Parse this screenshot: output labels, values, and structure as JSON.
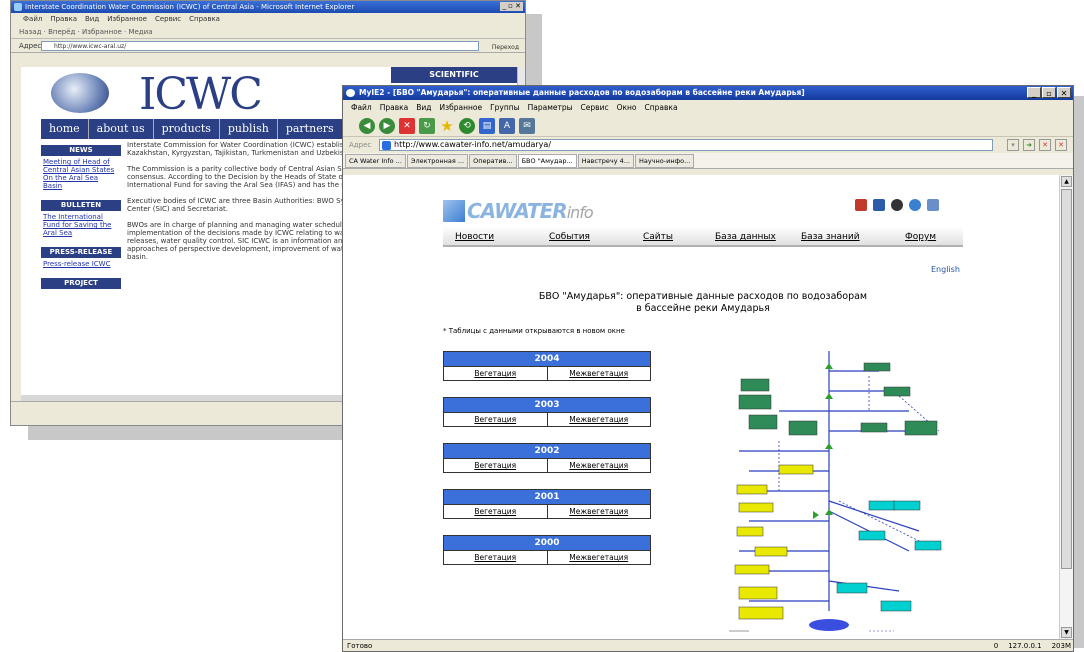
{
  "back_window": {
    "title": "Interstate Coordination Water Commission (ICWC) of Central Asia - Microsoft Internet Explorer",
    "menu": [
      "Файл",
      "Правка",
      "Вид",
      "Избранное",
      "Сервис",
      "Справка"
    ],
    "toolbar": "Назад · Вперёд · Избранное · Медиа",
    "address_label": "Адрес",
    "address": "http://www.icwc-aral.uz/",
    "go": "Переход",
    "scientific": "SCIENTIFIC",
    "logo": "ICWC",
    "nav": [
      "home",
      "about us",
      "products",
      "publish",
      "partners"
    ],
    "side": [
      {
        "header": "NEWS",
        "link": "Meeting of Head of Central Asian States On the Aral Sea Basin"
      },
      {
        "header": "BULLETEN",
        "link": "The International Fund for Saving the Aral Sea"
      },
      {
        "header": "PRESS-RELEASE",
        "link": "Press-release ICWC"
      },
      {
        "header": "PROJECT",
        "link": ""
      }
    ],
    "paragraphs": [
      "Interstate Commission for Water Coordination (ICWC) established after signing of the Agreement between Kazakhstan, Kyrgyzstan, Tajikistan, Turkmenistan and Uzbekistan on February 18, 1992.",
      "The Commission is a parity collective body of Central Asian States acting on the basis of equity, equality and consensus. According to the Decision by the Heads of State of March 1993, ICWC was included in the International Fund for saving the Aral Sea (IFAS) and has the status of an international organization.",
      "Executive bodies of ICWC are three Basin Authorities: BWO Syrdarya and Amudarya, Scientific-Information Center (SIC) and Secretariat.",
      "BWOs are in charge of planning and managing water schedules and water resources distribution, as well as implementation of the decisions made by ICWC relating to water allocation, schedules of water flow and releases, water quality control. SIC ICWC is an information and analytic center which develops methods and approaches of perspective development, improvement of water management and ecological situation in the basin."
    ]
  },
  "front_window": {
    "title": "MyIE2 - [БВО \"Амударья\": оперативные данные расходов по водозаборам в бассейне реки Амударья]",
    "menu": [
      "Файл",
      "Правка",
      "Вид",
      "Избранное",
      "Группы",
      "Параметры",
      "Сервис",
      "Окно",
      "Справка"
    ],
    "address_label": "Адрес",
    "address": "http://www.cawater-info.net/amudarya/",
    "tabs": [
      "CA Water Info ...",
      "Электронная ...",
      "Оператив...",
      "БВО \"Амудар...",
      "Навстречу 4...",
      "Научно-инфо..."
    ],
    "active_tab": 3,
    "status_left": "Готово",
    "status_count": "0",
    "status_ip": "127.0.0.1",
    "status_mem": "203M"
  },
  "page": {
    "logo_main": "CAWATER",
    "logo_sub": "info",
    "nav": [
      "Новости",
      "События",
      "Сайты",
      "База данных",
      "База знаний",
      "Форум"
    ],
    "english": "English",
    "title_line1": "БВО \"Амударья\": оперативные данные расходов по водозаборам",
    "title_line2": "в бассейне реки Амударья",
    "note": "* Таблицы с данными открываются в новом окне",
    "years": [
      {
        "year": "2004",
        "veg": "Вегетация",
        "nonveg": "Межвегетация"
      },
      {
        "year": "2003",
        "veg": "Вегетация",
        "nonveg": "Межвегетация"
      },
      {
        "year": "2002",
        "veg": "Вегетация",
        "nonveg": "Межвегетация"
      },
      {
        "year": "2001",
        "veg": "Вегетация",
        "nonveg": "Межвегетация"
      },
      {
        "year": "2000",
        "veg": "Вегетация",
        "nonveg": "Межвегетация"
      }
    ]
  },
  "colors": {
    "accent": "#3b6fd9",
    "icwc_blue": "#2b3f84",
    "xp_title": "#1f4fc0"
  }
}
